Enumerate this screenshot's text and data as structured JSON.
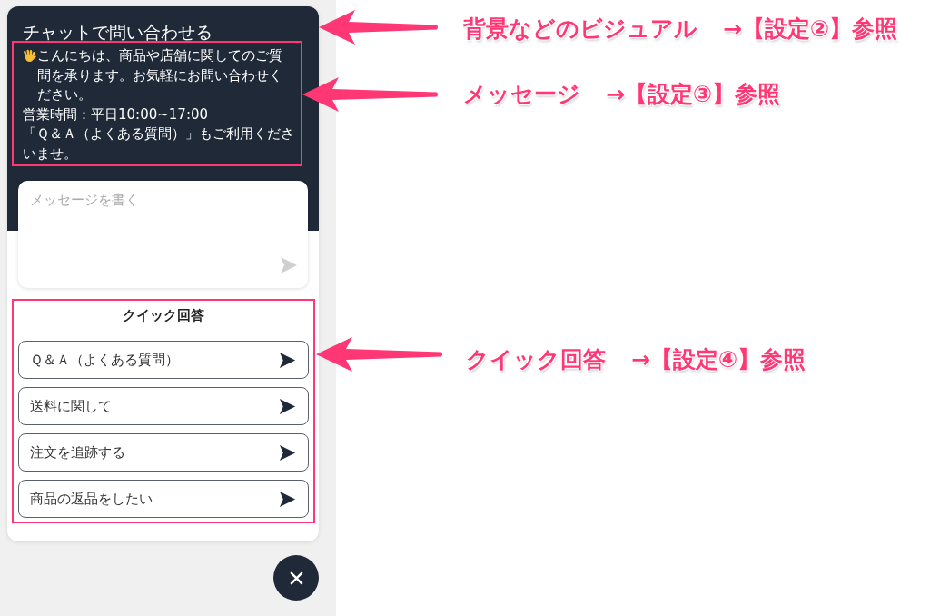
{
  "chat_widget": {
    "title": "チャットで問い合わせる",
    "message": {
      "highlighted": true,
      "paragraphs": [
        "こんにちは、商品や店舗に関してのご質問を承ります。お気軽にお問い合わせください。",
        "営業時間：平日10:00~17:00",
        "「Ｑ＆Ａ（よくある質問）」もご利用くださいませ。"
      ]
    },
    "input": {
      "placeholder": "メッセージを書く",
      "send_disabled": true
    },
    "quick_replies": {
      "highlighted": true,
      "title": "クイック回答",
      "items": [
        "Ｑ＆Ａ（よくある質問）",
        "送料に関して",
        "注文を追跡する",
        "商品の返品をしたい"
      ]
    }
  },
  "annotations": [
    {
      "label": "背景などのビジュアル",
      "reference": "→【設定②】参照"
    },
    {
      "label": "メッセージ",
      "reference": "→【設定③】参照"
    },
    {
      "label": "クイック回答",
      "reference": "→【設定④】参照"
    }
  ]
}
